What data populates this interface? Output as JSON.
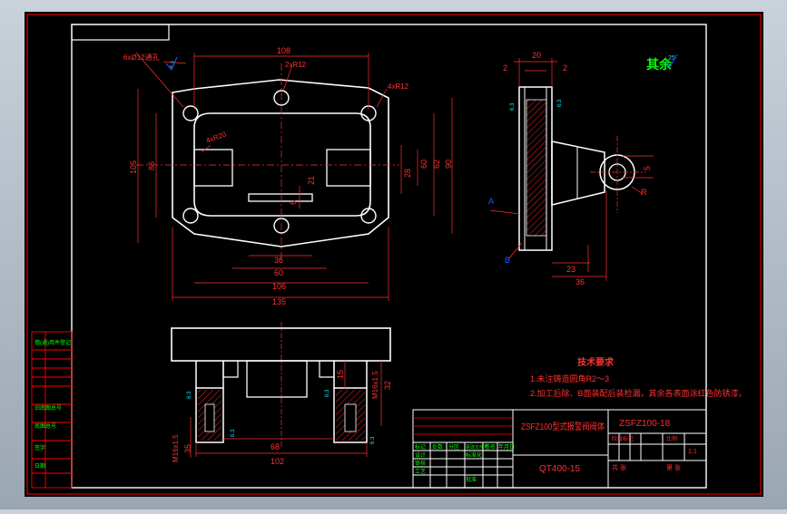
{
  "colors": {
    "background": "#000000",
    "frame": "#ff0000",
    "outline": "#ffffff",
    "dimension": "#ff3030",
    "green_text": "#00ff00",
    "blue_marker": "#1a5cff",
    "cyan_text": "#00e5ff"
  },
  "top_view": {
    "dims": {
      "d108": "108",
      "d2xR12": "2xR12",
      "d6x12": "6xØ12通孔",
      "d4xR12": "4xR12",
      "d4xR20": "4xR20",
      "d105": "105",
      "d86": "86",
      "d60r": "60",
      "d62": "62",
      "d90": "90",
      "d28": "28",
      "d21": "21",
      "d6": "6",
      "d36": "36",
      "d60b": "60",
      "d106": "106",
      "d135": "135",
      "ra": "6.3"
    }
  },
  "side_view": {
    "dims": {
      "d20": "20",
      "d2l": "2",
      "d2r": "2",
      "d5": "5",
      "dR": "R",
      "d23": "23",
      "d36": "36",
      "labelA": "A",
      "labelB": "B",
      "ra1": "6.3",
      "ra2": "6.3"
    }
  },
  "front_view": {
    "dims": {
      "d15": "15",
      "dM16l": "M16x1.5",
      "dM16r": "M16x1.5",
      "d32": "32",
      "d35": "35",
      "d68": "68",
      "d102": "102",
      "ra": [
        "6.3",
        "6.3",
        "6.3",
        "6.3"
      ]
    }
  },
  "roughness_note": {
    "label": "其余",
    "value": "25"
  },
  "tech_requirements": {
    "title": "技术要求",
    "items": [
      "1.未注铸造圆角R2～3",
      "2.加工后除、B面装配后装检漏，其余各表面涂红色防锈漆。"
    ]
  },
  "title_block": {
    "part_name": "ZSFZ100型式报警阀阀体",
    "drawing_no": "ZSFZ100-18",
    "material": "QT400-15",
    "scale": "1:1",
    "scale_label": "比例",
    "stage": "阶段标记",
    "cells": [
      "标记",
      "处数",
      "分区",
      "更改文件号",
      "签名",
      "年月日"
    ],
    "roles": [
      "设计",
      "标准化",
      "审核",
      "工艺",
      "批准"
    ],
    "sheet": "共 张",
    "sheet2": "第 张"
  },
  "left_table": {
    "rows": [
      "借(通)用件登记",
      "旧底图总号",
      "底图总号",
      "签字",
      "日期"
    ]
  }
}
